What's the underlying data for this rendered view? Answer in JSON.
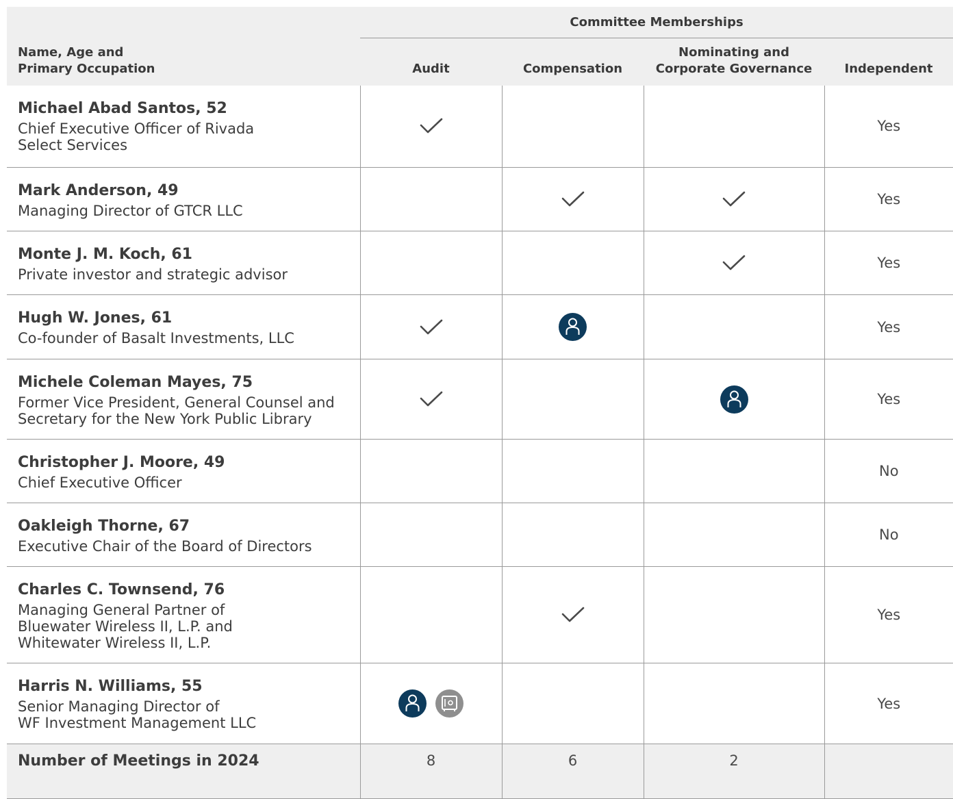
{
  "header": {
    "name_column": "Name, Age and\nPrimary Occupation",
    "committee_group": "Committee Memberships",
    "audit": "Audit",
    "compensation": "Compensation",
    "nominating": "Nominating and\nCorporate Governance",
    "independent": "Independent"
  },
  "directors": [
    {
      "name": "Michael Abad Santos, 52",
      "occupation": "Chief Executive Officer of Rivada\nSelect Services",
      "audit": "member",
      "compensation": "",
      "nominating": "",
      "independent": "Yes"
    },
    {
      "name": "Mark Anderson, 49",
      "occupation": "Managing Director of GTCR LLC",
      "audit": "",
      "compensation": "member",
      "nominating": "member",
      "independent": "Yes"
    },
    {
      "name": "Monte J. M. Koch, 61",
      "occupation": "Private investor and strategic advisor",
      "audit": "",
      "compensation": "",
      "nominating": "member",
      "independent": "Yes"
    },
    {
      "name": "Hugh W. Jones, 61",
      "occupation": "Co-founder of Basalt Investments, LLC",
      "audit": "member",
      "compensation": "chair",
      "nominating": "",
      "independent": "Yes"
    },
    {
      "name": "Michele Coleman Mayes, 75",
      "occupation": "Former Vice President, General Counsel and\nSecretary for the New York Public Library",
      "audit": "member",
      "compensation": "",
      "nominating": "chair",
      "independent": "Yes"
    },
    {
      "name": "Christopher J. Moore, 49",
      "occupation": "Chief Executive Officer",
      "audit": "",
      "compensation": "",
      "nominating": "",
      "independent": "No"
    },
    {
      "name": "Oakleigh Thorne, 67",
      "occupation": "Executive Chair of the Board of Directors",
      "audit": "",
      "compensation": "",
      "nominating": "",
      "independent": "No"
    },
    {
      "name": "Charles C. Townsend, 76",
      "occupation": "Managing General Partner of\nBluewater Wireless II, L.P. and\nWhitewater Wireless II, L.P.",
      "audit": "",
      "compensation": "member",
      "nominating": "",
      "independent": "Yes"
    },
    {
      "name": "Harris N. Williams, 55",
      "occupation": "Senior Managing Director of\nWF Investment Management LLC",
      "audit": "chair+financial-expert",
      "compensation": "",
      "nominating": "",
      "independent": "Yes"
    }
  ],
  "meetings": {
    "label": "Number of Meetings in 2024",
    "audit": "8",
    "compensation": "6",
    "nominating": "2",
    "independent": ""
  },
  "icons": {
    "member": "checkmark-icon",
    "chair": "chair-person-icon",
    "financial_expert": "safe-icon"
  },
  "colors": {
    "header_bg": "#efefef",
    "chair": "#0d3b5c",
    "financial_expert": "#8f8f8f",
    "rule": "#9a9a9a"
  }
}
